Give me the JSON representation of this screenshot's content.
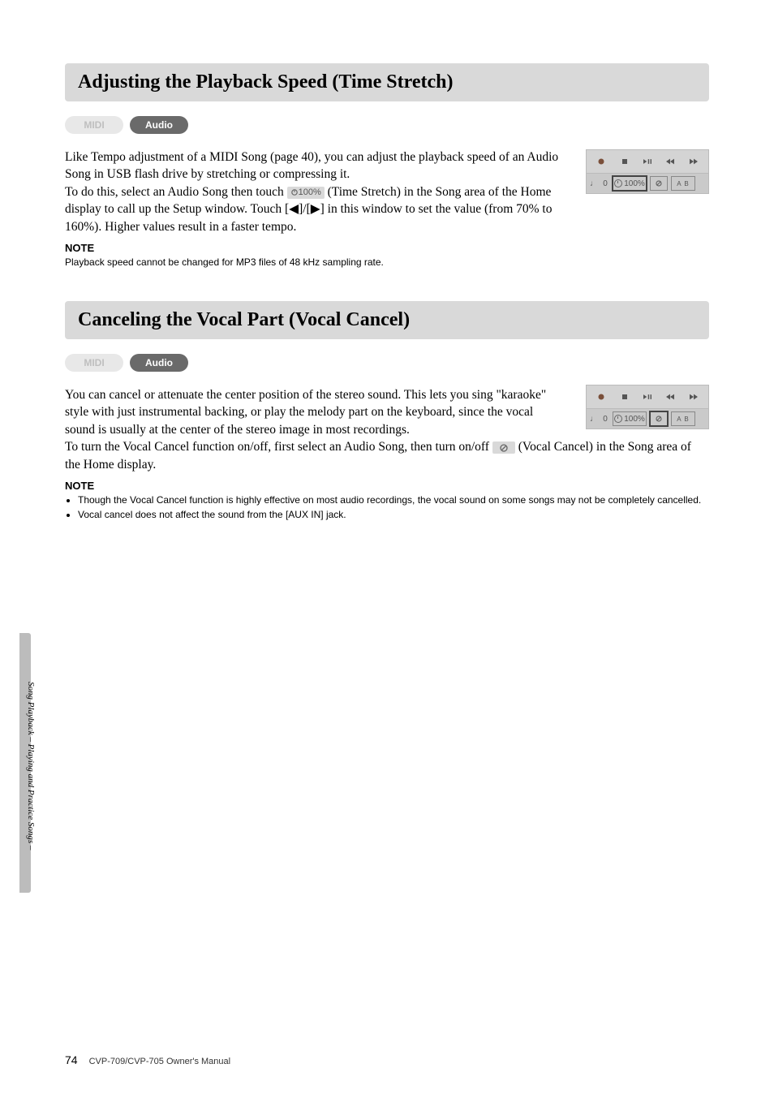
{
  "section1": {
    "heading": "Adjusting the Playback Speed (Time Stretch)",
    "tag_midi": "MIDI",
    "tag_audio": "Audio",
    "p1": "Like Tempo adjustment of a MIDI Song (page 40), you can adjust the playback speed of an Audio Song in USB flash drive by stretching or compressing it.",
    "p2a": "To do this, select an Audio Song then touch ",
    "time_stretch_icon_label": "100%",
    "p2b": " (Time Stretch) in the Song area of the Home display to call up the Setup window. Touch [◀]/[▶] in this window to set the value (from 70% to 160%). Higher values result in a faster tempo.",
    "note_head": "NOTE",
    "note_body": "Playback speed cannot be changed for MP3 files of 48 kHz sampling rate."
  },
  "section2": {
    "heading": "Canceling the Vocal Part (Vocal Cancel)",
    "tag_midi": "MIDI",
    "tag_audio": "Audio",
    "p1": "You can cancel or attenuate the center position of the stereo sound. This lets you sing \"karaoke\" style with just instrumental backing, or play the melody part on the keyboard, since the vocal sound is usually at the center of the stereo image in most recordings.",
    "p2a": "To turn the Vocal Cancel function on/off, first select an Audio Song, then turn on/off ",
    "p2b": " (Vocal Cancel) in the Song area of the Home display.",
    "note_head": "NOTE",
    "note_li1": "Though the Vocal Cancel function is highly effective on most audio recordings, the vocal sound on some songs may not be completely cancelled.",
    "note_li2": "Vocal cancel does not affect the sound from the [AUX IN] jack."
  },
  "panel": {
    "zero": "0",
    "hundred": "100%",
    "ab": "A  B",
    "note_glyph": "♩"
  },
  "side_text": "Song Playback – Playing and Practice Songs –",
  "footer": {
    "page": "74",
    "manual": "CVP-709/CVP-705 Owner's Manual"
  },
  "icons": {
    "record": "record-icon",
    "stop": "stop-icon",
    "playpause": "play-pause-icon",
    "rew": "rewind-icon",
    "ff": "fast-forward-icon"
  }
}
